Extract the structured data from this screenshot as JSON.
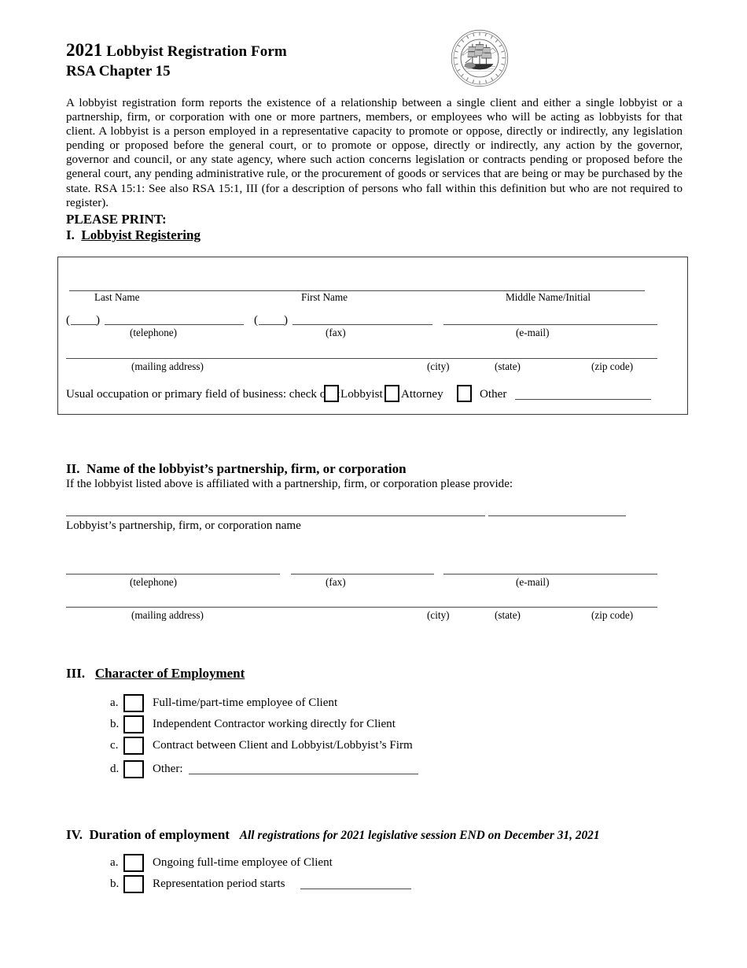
{
  "header": {
    "year": "2021",
    "title": "Lobbyist Registration Form",
    "subtitle": "RSA Chapter 15",
    "seal_name": "state-seal-new-hampshire"
  },
  "intro": {
    "paragraph": "A lobbyist registration form reports the existence of a relationship between a single client and either a single lobbyist or a partnership, firm, or corporation with one or more partners, members, or employees who will be acting as lobbyists for that client.  A lobbyist is a person employed in a representative capacity to promote or oppose, directly or indirectly, any legislation pending or proposed before the general court, or to promote or oppose, directly or indirectly, any action by the governor, governor and council, or any state agency, where such action concerns legislation or contracts pending or proposed before the general court, any pending administrative rule, or the procurement of goods or services that are being or may be purchased by the state.  RSA 15:1:  See also RSA 15:1, III (for a description of persons who fall within this definition but who are not required to register)."
  },
  "please_print": "PLEASE PRINT:",
  "section1": {
    "number": "I.",
    "heading": "Lobbyist Registering",
    "labels": {
      "last_name": "Last Name",
      "first_name": "First Name",
      "middle_name": "Middle Name/Initial",
      "telephone": "(telephone)",
      "fax": "(fax)",
      "email": "(e-mail)",
      "mailing_address": "(mailing address)",
      "city": "(city)",
      "state": "(state)",
      "zip_code": "(zip code)"
    },
    "area_code_open": "(",
    "area_code_close": ")",
    "occupation_prompt": "Usual occupation or primary field of business: check one:",
    "occupation_options": [
      {
        "label": "Lobbyist",
        "checked": false
      },
      {
        "label": "Attorney",
        "checked": false
      },
      {
        "label": "Other",
        "checked": false
      }
    ]
  },
  "section2": {
    "number": "II.",
    "heading": "Name of the lobbyist’s partnership, firm, or corporation",
    "subtext": "If the lobbyist listed above is affiliated with a partnership, firm, or corporation please provide:",
    "name_label": "Lobbyist’s partnership, firm, or corporation name",
    "labels": {
      "telephone": "(telephone)",
      "fax": "(fax)",
      "email": "(e-mail)",
      "mailing_address": "(mailing address)",
      "city": "(city)",
      "state": "(state)",
      "zip_code": "(zip code)"
    }
  },
  "section3": {
    "number": "III.",
    "heading": "Character of Employment",
    "options": [
      {
        "letter": "a.",
        "label": "Full-time/part-time employee of Client",
        "checked": false
      },
      {
        "letter": "b.",
        "label": "Independent Contractor working directly for Client",
        "checked": false
      },
      {
        "letter": "c.",
        "label": "Contract between Client and Lobbyist/Lobbyist’s Firm",
        "checked": false
      },
      {
        "letter": "d.",
        "label": "Other:",
        "checked": false
      }
    ]
  },
  "section4": {
    "number": "IV.",
    "heading": "Duration of employment",
    "note": "All registrations for 2021 legislative session END on December 31, 2021",
    "options": [
      {
        "letter": "a.",
        "label": "Ongoing full-time employee of Client",
        "checked": false
      },
      {
        "letter": "b.",
        "label": "Representation period starts",
        "checked": false
      }
    ]
  },
  "colors": {
    "text": "#000000",
    "rule": "#4a4a4a",
    "box_border": "#3a3a3a",
    "page_background": "#ffffff"
  }
}
